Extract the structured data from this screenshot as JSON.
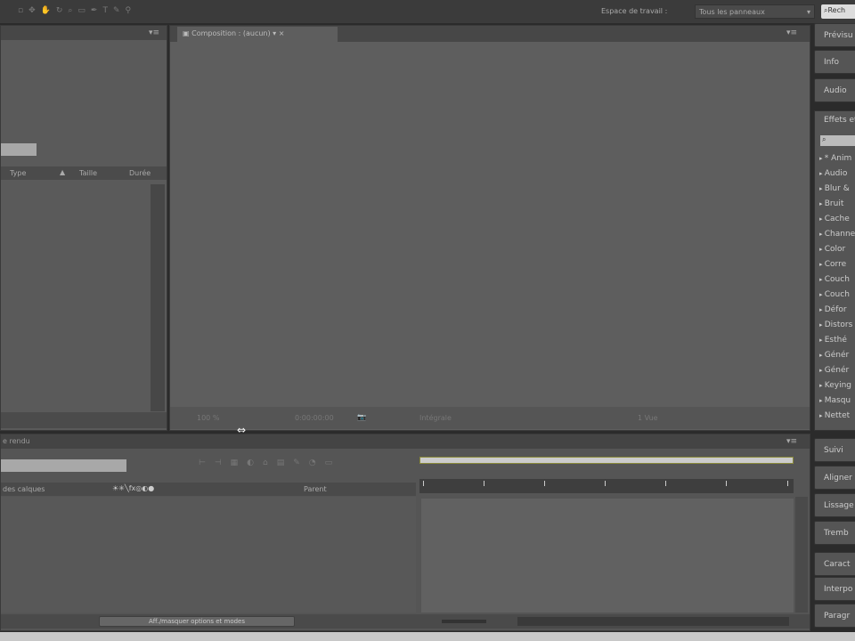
{
  "topbar": {
    "workspace_label": "Espace de travail :",
    "workspace_value": "Tous les panneaux",
    "search_label": "Rech"
  },
  "project": {
    "columns": [
      "Type",
      "Taille",
      "Durée"
    ]
  },
  "composition": {
    "tab": "Composition : (aucun)",
    "zoom": "100 %",
    "timecode": "0:00:00:00",
    "resolution": "Intégrale",
    "views": "1 Vue"
  },
  "render": {
    "tab": "e rendu"
  },
  "timeline": {
    "col_layer": "des calques",
    "col_parent": "Parent",
    "toggle_label": "Aff./masquer options et modes"
  },
  "right": {
    "top": [
      "Prévisu",
      "Info",
      "Audio"
    ],
    "effects_title": "Effets et",
    "effects": [
      "* Anim",
      "Audio",
      "Blur &",
      "Bruit",
      "Cache",
      "Channel",
      "Color",
      "Corre",
      "Couch",
      "Couch",
      "Défor",
      "Distors",
      "Esthé",
      "Génér",
      "Génér",
      "Keying",
      "Masqu",
      "Nettet"
    ],
    "bottom": [
      "Suivi",
      "Aligner",
      "Lissage",
      "Tremb",
      "Caract",
      "Interpo",
      "Paragr"
    ]
  }
}
